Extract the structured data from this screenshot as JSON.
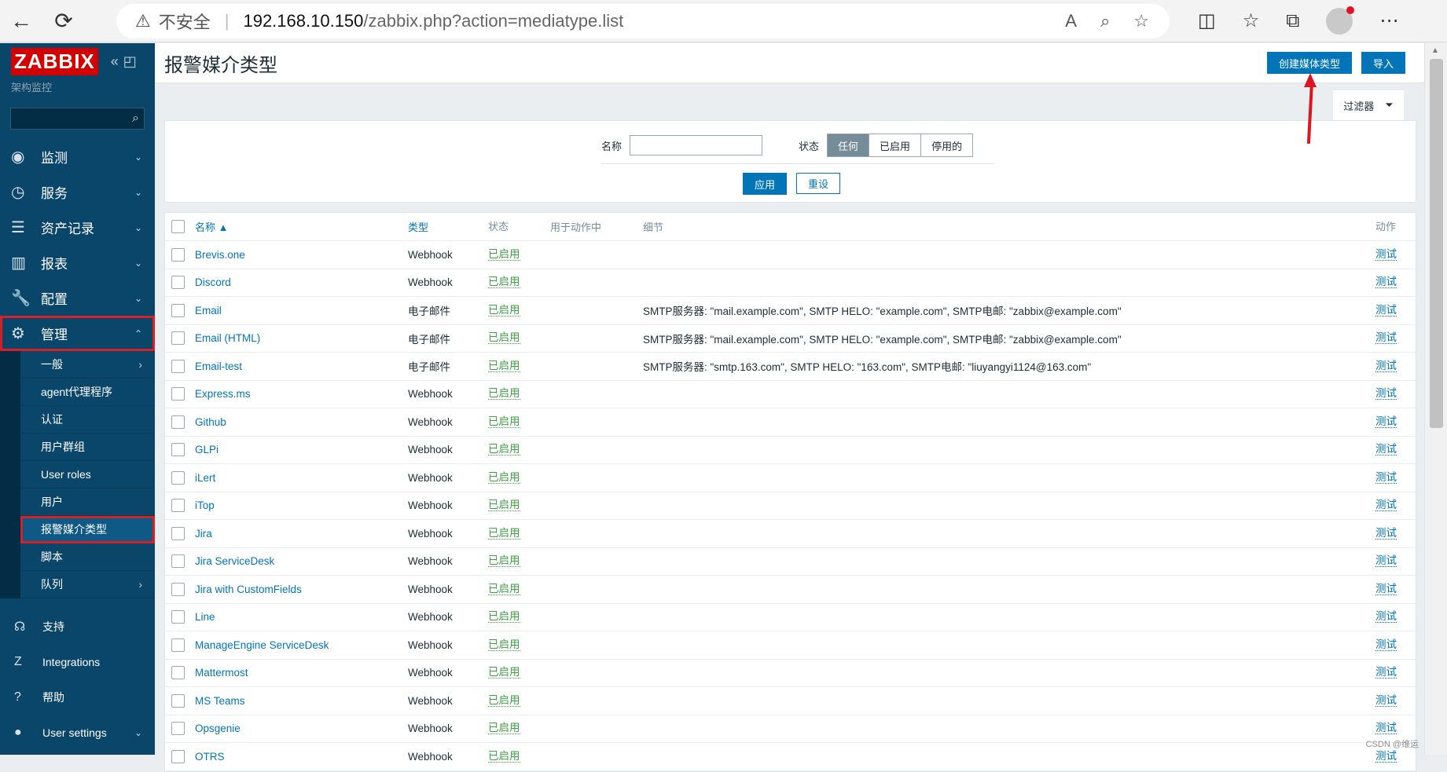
{
  "browser": {
    "warning": "不安全",
    "host": "192.168.10.150",
    "path": "/zabbix.php?action=mediatype.list"
  },
  "sidebar": {
    "logo": "ZABBIX",
    "subtitle": "架构监控",
    "menu": [
      {
        "label": "监测",
        "icon": "eye-icon"
      },
      {
        "label": "服务",
        "icon": "clock-icon"
      },
      {
        "label": "资产记录",
        "icon": "list-icon"
      },
      {
        "label": "报表",
        "icon": "chart-icon"
      },
      {
        "label": "配置",
        "icon": "wrench-icon"
      },
      {
        "label": "管理",
        "icon": "gear-icon"
      }
    ],
    "submenu": [
      "一般",
      "agent代理程序",
      "认证",
      "用户群组",
      "User roles",
      "用户",
      "报警媒介类型",
      "脚本",
      "队列"
    ],
    "bottom": [
      {
        "label": "支持",
        "icon": "headset-icon"
      },
      {
        "label": "Integrations",
        "icon": "z-icon"
      },
      {
        "label": "帮助",
        "icon": "help-icon"
      },
      {
        "label": "User settings",
        "icon": "user-icon"
      }
    ]
  },
  "header": {
    "title": "报警媒介类型",
    "create_button": "创建媒体类型",
    "import_button": "导入"
  },
  "filter": {
    "tab_label": "过滤器",
    "name_label": "名称",
    "name_value": "",
    "state_label": "状态",
    "state_options": [
      "任何",
      "已启用",
      "停用的"
    ],
    "apply": "应用",
    "reset": "重设"
  },
  "table": {
    "headers": {
      "name": "名称 ▲",
      "type": "类型",
      "status": "状态",
      "used": "用于动作中",
      "details": "细节",
      "action": "动作"
    },
    "rows": [
      {
        "name": "Brevis.one",
        "type": "Webhook",
        "status": "已启用",
        "details": "",
        "action": "测试"
      },
      {
        "name": "Discord",
        "type": "Webhook",
        "status": "已启用",
        "details": "",
        "action": "测试"
      },
      {
        "name": "Email",
        "type": "电子邮件",
        "status": "已启用",
        "details": "SMTP服务器: \"mail.example.com\", SMTP HELO: \"example.com\", SMTP电邮: \"zabbix@example.com\"",
        "action": "测试"
      },
      {
        "name": "Email (HTML)",
        "type": "电子邮件",
        "status": "已启用",
        "details": "SMTP服务器: \"mail.example.com\", SMTP HELO: \"example.com\", SMTP电邮: \"zabbix@example.com\"",
        "action": "测试"
      },
      {
        "name": "Email-test",
        "type": "电子邮件",
        "status": "已启用",
        "details": "SMTP服务器: \"smtp.163.com\", SMTP HELO: \"163.com\", SMTP电邮: \"liuyangyi1124@163.com\"",
        "action": "测试"
      },
      {
        "name": "Express.ms",
        "type": "Webhook",
        "status": "已启用",
        "details": "",
        "action": "测试"
      },
      {
        "name": "Github",
        "type": "Webhook",
        "status": "已启用",
        "details": "",
        "action": "测试"
      },
      {
        "name": "GLPi",
        "type": "Webhook",
        "status": "已启用",
        "details": "",
        "action": "测试"
      },
      {
        "name": "iLert",
        "type": "Webhook",
        "status": "已启用",
        "details": "",
        "action": "测试"
      },
      {
        "name": "iTop",
        "type": "Webhook",
        "status": "已启用",
        "details": "",
        "action": "测试"
      },
      {
        "name": "Jira",
        "type": "Webhook",
        "status": "已启用",
        "details": "",
        "action": "测试"
      },
      {
        "name": "Jira ServiceDesk",
        "type": "Webhook",
        "status": "已启用",
        "details": "",
        "action": "测试"
      },
      {
        "name": "Jira with CustomFields",
        "type": "Webhook",
        "status": "已启用",
        "details": "",
        "action": "测试"
      },
      {
        "name": "Line",
        "type": "Webhook",
        "status": "已启用",
        "details": "",
        "action": "测试"
      },
      {
        "name": "ManageEngine ServiceDesk",
        "type": "Webhook",
        "status": "已启用",
        "details": "",
        "action": "测试"
      },
      {
        "name": "Mattermost",
        "type": "Webhook",
        "status": "已启用",
        "details": "",
        "action": "测试"
      },
      {
        "name": "MS Teams",
        "type": "Webhook",
        "status": "已启用",
        "details": "",
        "action": "测试"
      },
      {
        "name": "Opsgenie",
        "type": "Webhook",
        "status": "已启用",
        "details": "",
        "action": "测试"
      },
      {
        "name": "OTRS",
        "type": "Webhook",
        "status": "已启用",
        "details": "",
        "action": "测试"
      }
    ]
  },
  "watermark": "CSDN @维运",
  "colors": {
    "sidebar": "#0a466a",
    "accent": "#0275b8",
    "enabled": "#429e47",
    "highlight": "#d62026"
  }
}
